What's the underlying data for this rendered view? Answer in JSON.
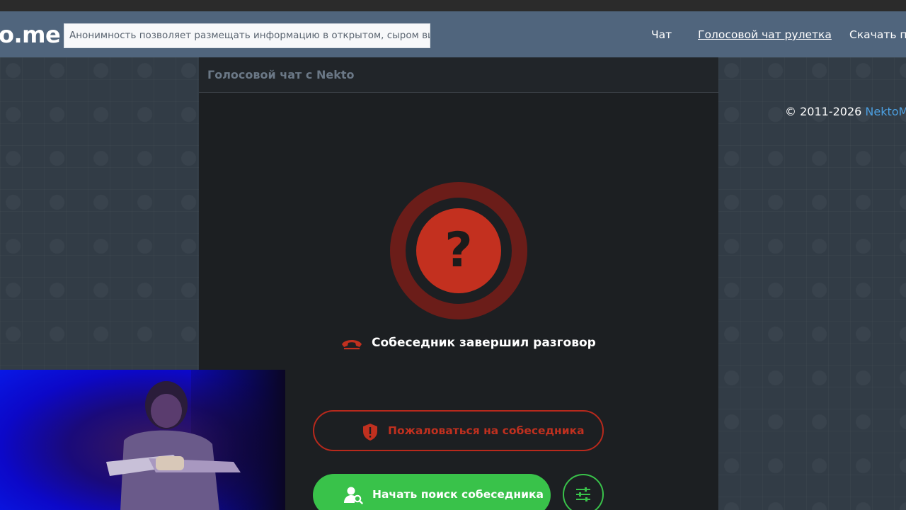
{
  "header": {
    "logo": "o.me",
    "slogan": "Анонимность позволяет размещать информацию в открытом, сыром виде!",
    "nav": [
      {
        "label": "Чат",
        "active": false
      },
      {
        "label": "Голосовой чат рулетка",
        "active": true
      },
      {
        "label": "Скачать пр",
        "active": false
      }
    ]
  },
  "main": {
    "title": "Голосовой чат с Nekto",
    "status_icon": "question-mark-icon",
    "status_symbol": "?",
    "status_text": "Собеседник завершил разговор",
    "report_button": "Пожаловаться на собеседника",
    "search_button": "Начать поиск собеседника"
  },
  "footer": {
    "copyright": "© 2011-2026",
    "brand": "NektoMe"
  },
  "colors": {
    "navbar": "#50657d",
    "accent_red": "#c3301f",
    "accent_green": "#39c24a",
    "link_blue": "#4c9fe0"
  }
}
